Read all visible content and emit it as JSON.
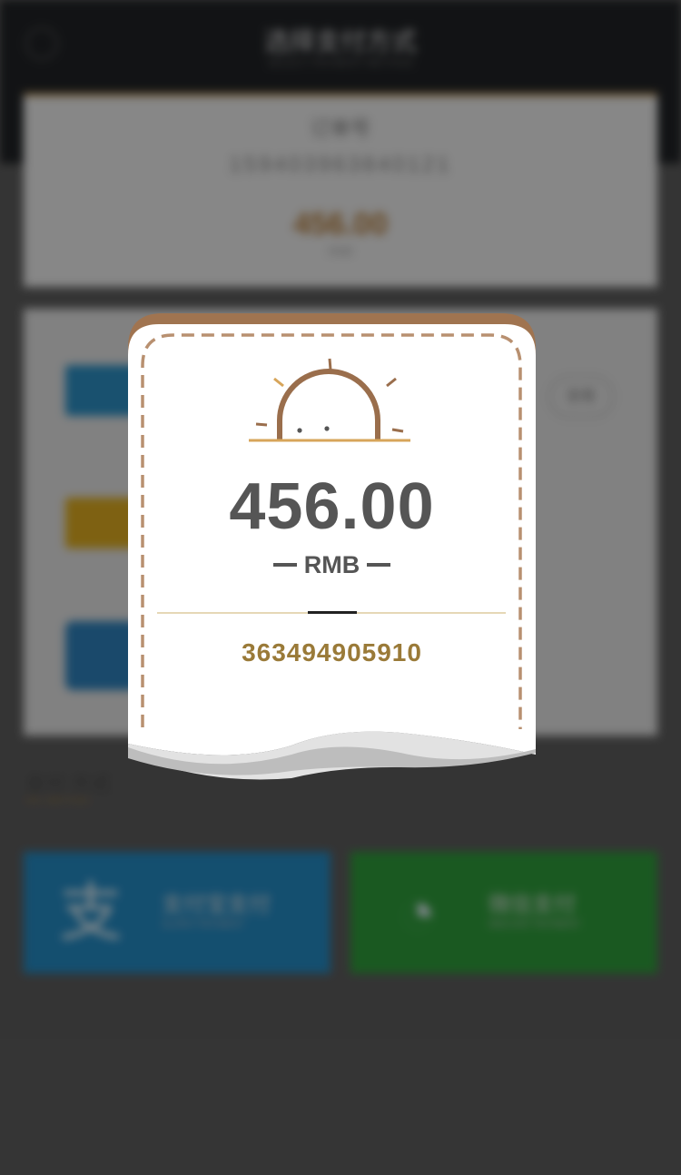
{
  "background": {
    "page_title": "选择支付方式",
    "page_subtitle": "SELECT PAYMENT METHOD",
    "order_label": "订单号",
    "order_number": "15940396384012​1",
    "order_amount": "456.00",
    "order_unit": "RMB",
    "list_button": "查看",
    "pay_section_title": "支付 方式",
    "pay_section_subtitle": "PAY METHOD",
    "alipay_label": "支付宝支付",
    "alipay_sub": "ALIPAY PAYMENT",
    "wechat_label": "微信支付",
    "wechat_sub": "WECHAT PAYMENT"
  },
  "receipt": {
    "icon": "sunrise-icon",
    "amount": "456.00",
    "currency": "RMB",
    "code": "363494905910"
  },
  "colors": {
    "accent_brown": "#a07450",
    "amount_text": "#555555",
    "code_text": "#9a7a38",
    "divider": "#e6d8b6"
  }
}
